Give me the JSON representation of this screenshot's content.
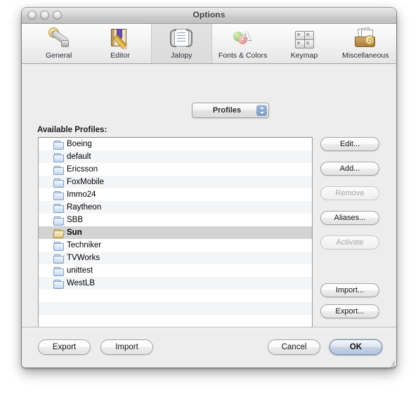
{
  "window": {
    "title": "Options",
    "traffic_lights": [
      "close-button",
      "minimize-button",
      "zoom-button"
    ]
  },
  "toolbar": {
    "items": [
      {
        "label": "General",
        "icon": "gear-wrench-icon",
        "selected": false
      },
      {
        "label": "Editor",
        "icon": "book-pencil-icon",
        "selected": false
      },
      {
        "label": "Jalopy",
        "icon": "document-braces-icon",
        "selected": true
      },
      {
        "label": "Fonts & Colors",
        "icon": "fonts-colors-icon",
        "selected": false
      },
      {
        "label": "Keymap",
        "icon": "keyboard-keys-icon",
        "selected": false
      },
      {
        "label": "Miscellaneous",
        "icon": "tray-pages-gear-icon",
        "selected": false
      }
    ]
  },
  "panel": {
    "popup": {
      "selected": "Profiles",
      "options": [
        "Profiles"
      ]
    },
    "list_caption": "Available Profiles:",
    "profiles": [
      {
        "name": "Boeing",
        "selected": false
      },
      {
        "name": "default",
        "selected": false
      },
      {
        "name": "Ericsson",
        "selected": false
      },
      {
        "name": "FoxMobile",
        "selected": false
      },
      {
        "name": "Immo24",
        "selected": false
      },
      {
        "name": "Raytheon",
        "selected": false
      },
      {
        "name": "SBB",
        "selected": false
      },
      {
        "name": "Sun",
        "selected": true
      },
      {
        "name": "Techniker",
        "selected": false
      },
      {
        "name": "TVWorks",
        "selected": false
      },
      {
        "name": "unittest",
        "selected": false
      },
      {
        "name": "WestLB",
        "selected": false
      }
    ],
    "empty_rows": 3,
    "side_buttons": [
      {
        "label": "Edit...",
        "enabled": true
      },
      {
        "label": "Add...",
        "enabled": true
      },
      {
        "label": "Remove",
        "enabled": false
      },
      {
        "label": "Aliases...",
        "enabled": true
      },
      {
        "label": "Activate",
        "enabled": false
      }
    ],
    "transfer_buttons": [
      {
        "label": "Import...",
        "enabled": true
      },
      {
        "label": "Export...",
        "enabled": true
      }
    ]
  },
  "footer": {
    "left_buttons": [
      {
        "label": "Export"
      },
      {
        "label": "Import"
      }
    ],
    "right_buttons": [
      {
        "label": "Cancel",
        "default": false
      },
      {
        "label": "OK",
        "default": true
      }
    ]
  },
  "colors": {
    "selection": "#d3d3d3",
    "panel_bg": "#ededed",
    "default_button": "#b3c5de",
    "folder_blue": "#c2d6ef",
    "folder_open_tan": "#e0c878"
  }
}
